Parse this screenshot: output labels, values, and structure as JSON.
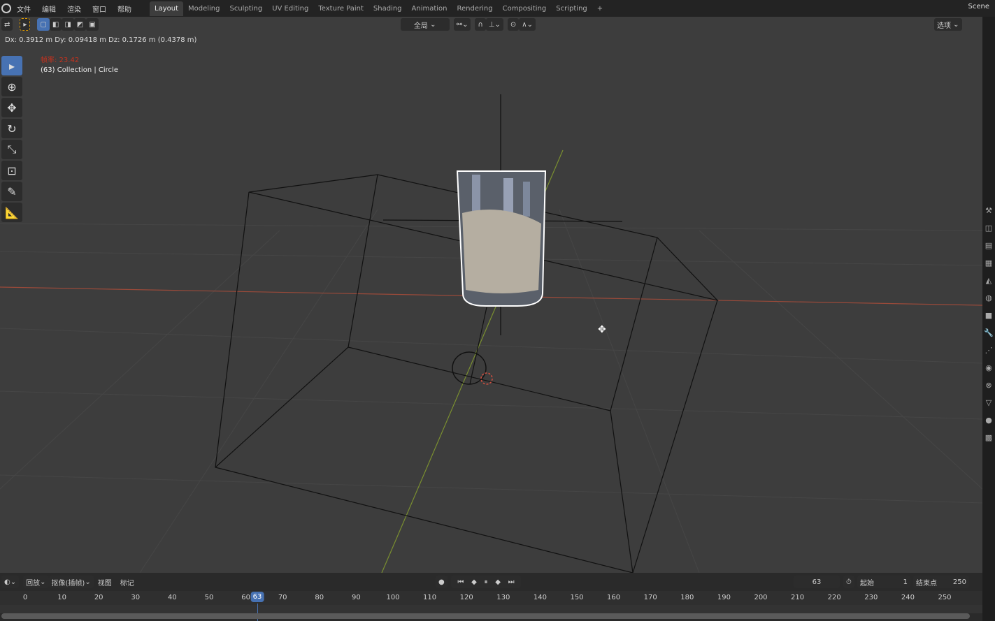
{
  "menu": [
    "文件",
    "编辑",
    "渲染",
    "窗口",
    "帮助"
  ],
  "workspaces": [
    "Layout",
    "Modeling",
    "Sculpting",
    "UV Editing",
    "Texture Paint",
    "Shading",
    "Animation",
    "Rendering",
    "Compositing",
    "Scripting"
  ],
  "add_tab": "+",
  "scene": "Scene",
  "header": {
    "transform_orientation": "全局",
    "options": "选项"
  },
  "viewport": {
    "readout": "Dx: 0.3912 m  Dy: 0.09418 m  Dz: 0.1726 m (0.4378 m)",
    "fps": "帧率: 23.42",
    "collection": "(63) Collection | Circle"
  },
  "timeline": {
    "playback": "回放",
    "keying": "抠像(插帧)",
    "view": "视图",
    "marker": "标记",
    "current_frame": "63",
    "start_label": "起始",
    "start": "1",
    "end_label": "结束点",
    "end": "250",
    "ticks": [
      "0",
      "10",
      "20",
      "30",
      "40",
      "50",
      "60",
      "70",
      "80",
      "90",
      "100",
      "110",
      "120",
      "130",
      "140",
      "150",
      "160",
      "170",
      "180",
      "190",
      "200",
      "210",
      "220",
      "230",
      "240",
      "250"
    ]
  },
  "colors": {
    "accent": "#4772b3",
    "x_axis": "#c0503a",
    "y_axis": "#8aa035"
  }
}
